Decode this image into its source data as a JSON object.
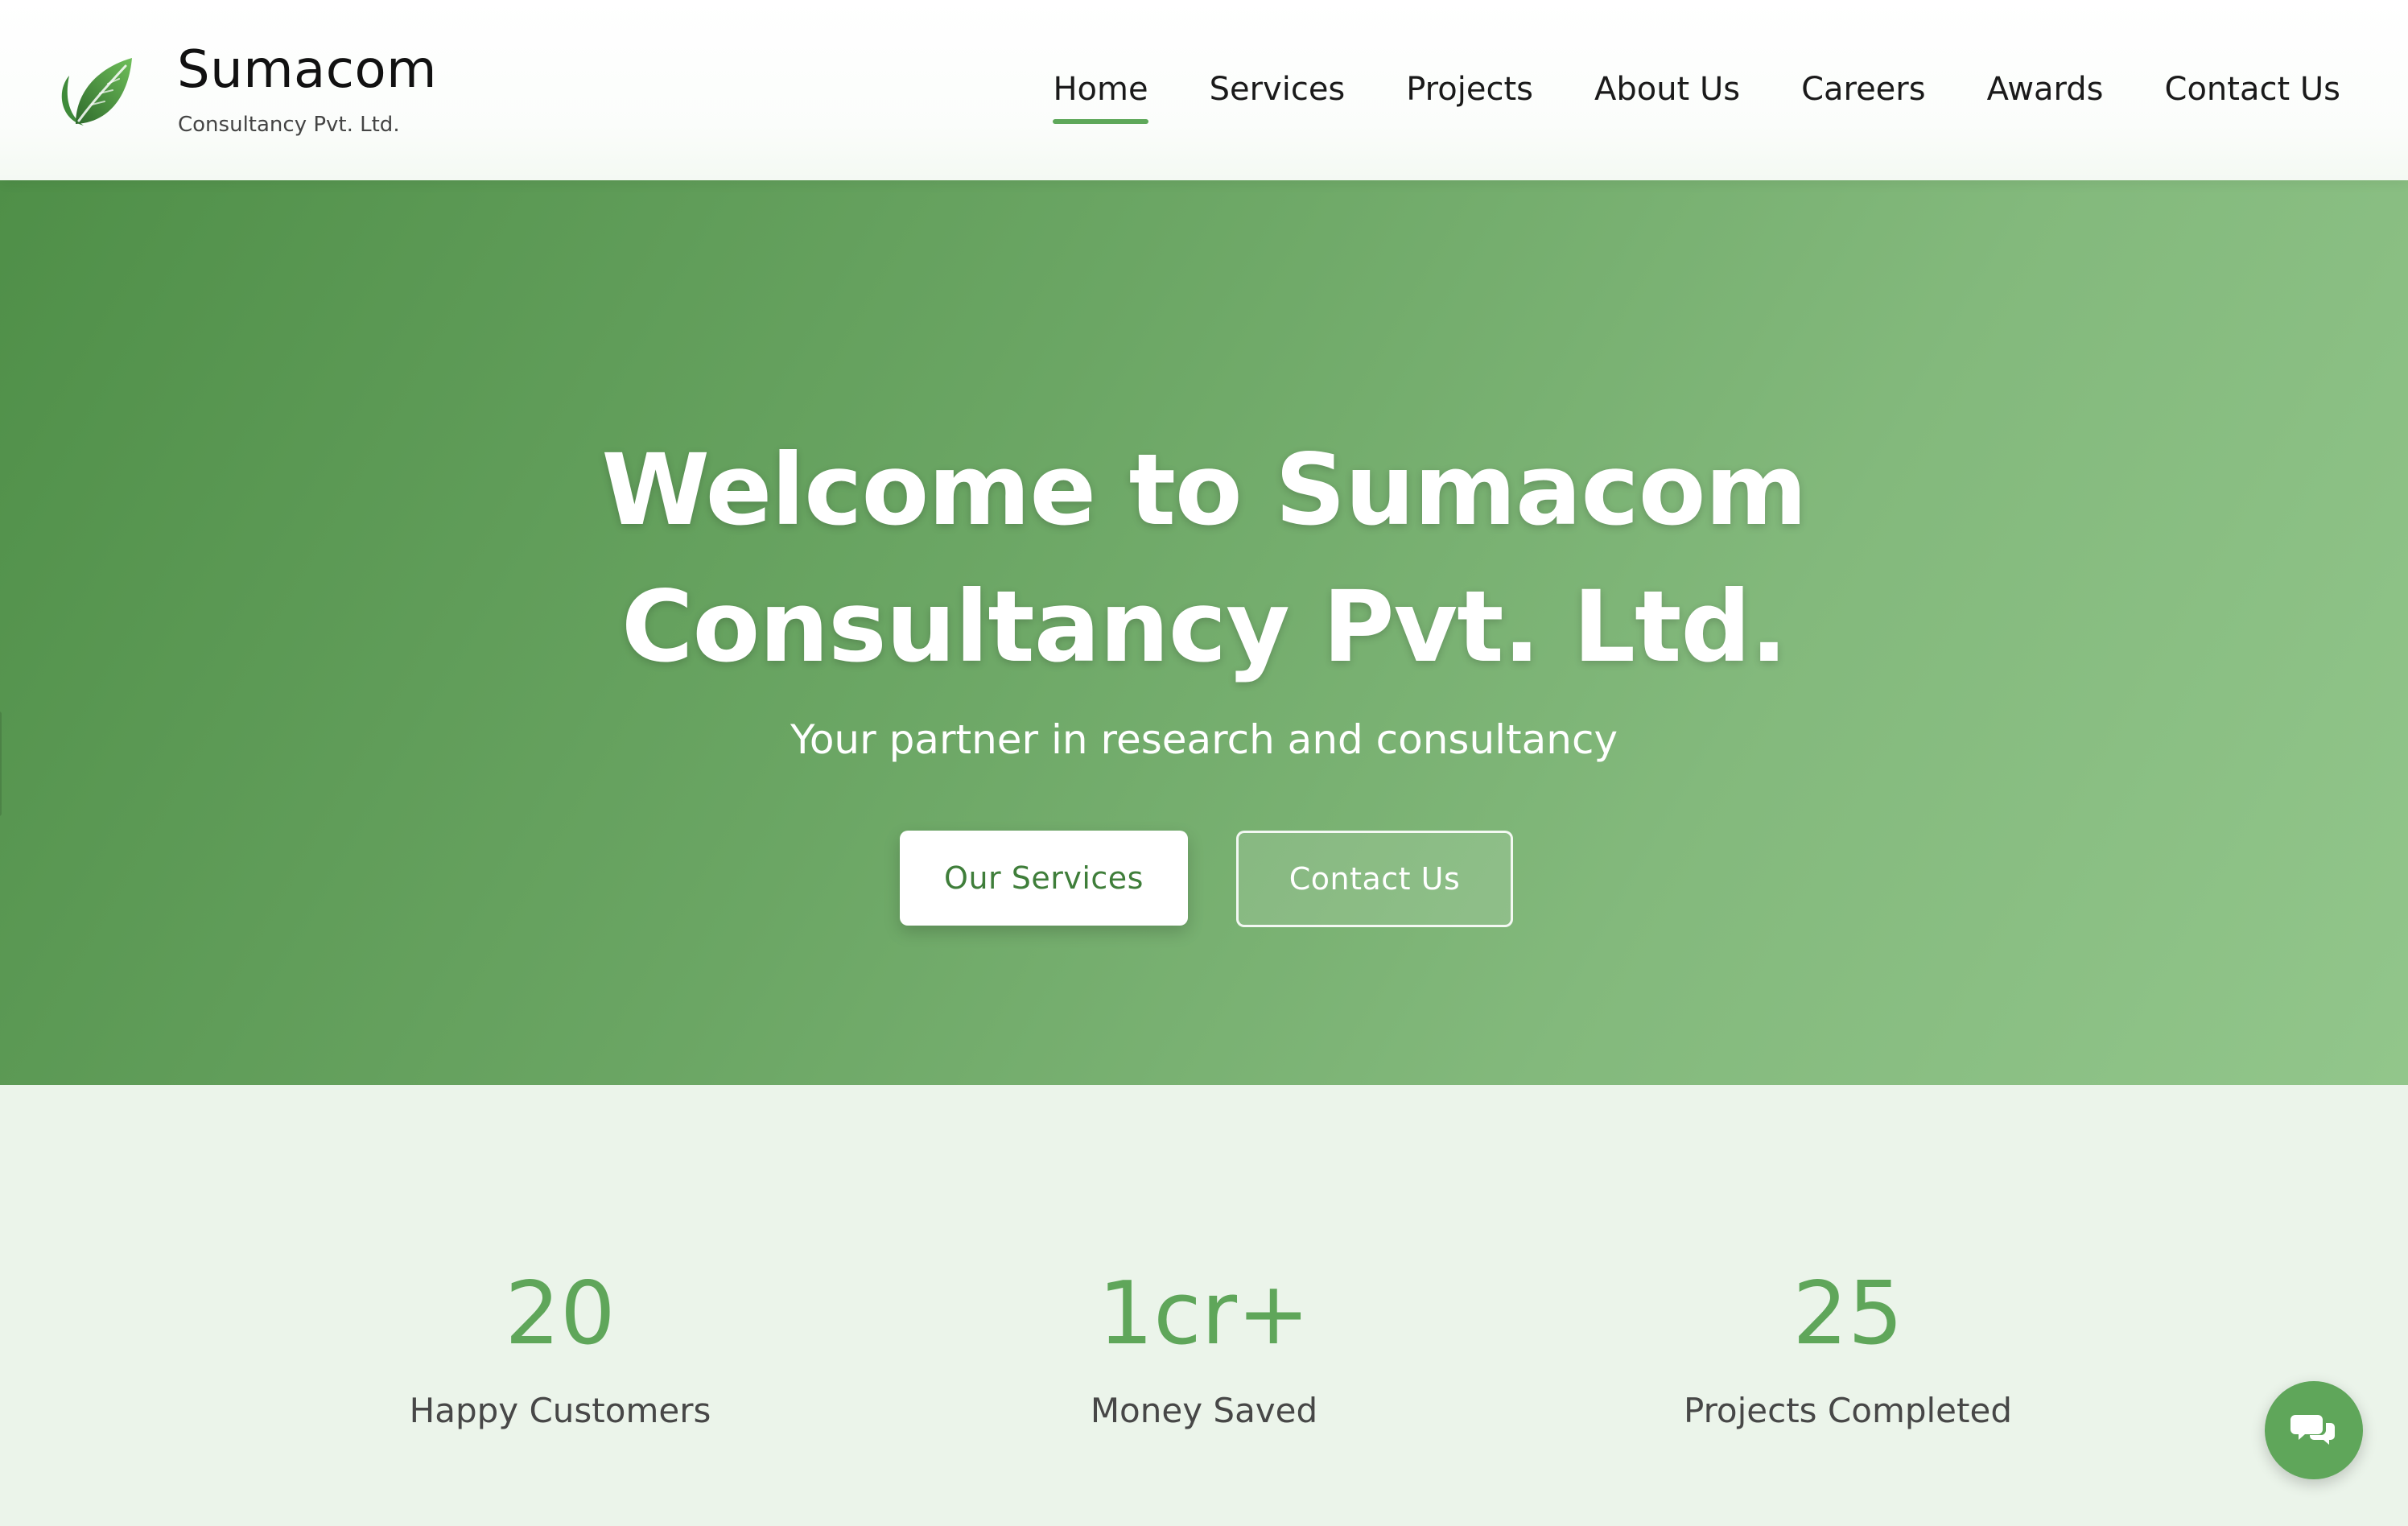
{
  "header": {
    "brand_name": "Sumacom",
    "brand_subtitle": "Consultancy Pvt. Ltd.",
    "logo_icon": "leaf-logo-icon",
    "nav": [
      {
        "label": "Home",
        "active": true
      },
      {
        "label": "Services",
        "active": false
      },
      {
        "label": "Projects",
        "active": false
      },
      {
        "label": "About Us",
        "active": false
      },
      {
        "label": "Careers",
        "active": false
      },
      {
        "label": "Awards",
        "active": false
      },
      {
        "label": "Contact Us",
        "active": false
      }
    ]
  },
  "hero": {
    "title_line1": "Welcome to Sumacom",
    "title_line2": "Consultancy Pvt. Ltd.",
    "subtitle": "Your partner in research and consultancy",
    "primary_button": "Our Services",
    "secondary_button": "Contact Us"
  },
  "stats": [
    {
      "value": "20",
      "label": "Happy Customers"
    },
    {
      "value": "1cr+",
      "label": "Money Saved"
    },
    {
      "value": "25",
      "label": "Projects Completed"
    }
  ],
  "chat": {
    "icon": "chat-bubbles-icon"
  },
  "colors": {
    "accent": "#5fa65a",
    "hero_start": "#4f8f48",
    "hero_end": "#92c68b",
    "stats_background": "#ebf4ea"
  }
}
